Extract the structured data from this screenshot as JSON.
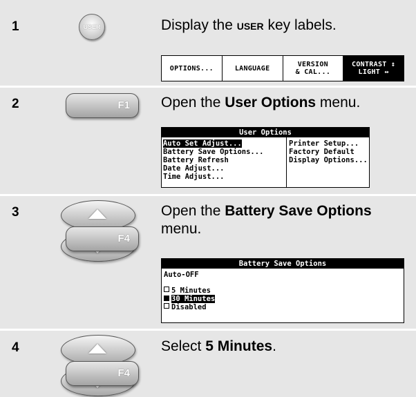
{
  "steps": [
    {
      "number": "1",
      "key": "USER",
      "instruction_pre": "Display the ",
      "instruction_key": "USER",
      "instruction_post": " key labels.",
      "softkeys": [
        "OPTIONS...",
        "LANGUAGE",
        "VERSION\n& CAL...",
        "CONTRAST ↕\nLIGHT ↔"
      ]
    },
    {
      "number": "2",
      "key": "F1",
      "instruction_pre": "Open the ",
      "instruction_bold": "User Options",
      "instruction_post": " menu.",
      "menu_title": "User Options",
      "left_items": [
        "Auto Set Adjust...",
        "Battery Save Options...",
        "Battery Refresh",
        "Date Adjust...",
        "Time Adjust..."
      ],
      "right_items": [
        "Printer Setup...",
        "Factory Default",
        "Display Options..."
      ]
    },
    {
      "number": "3",
      "key": "F4",
      "instruction_pre": "Open the ",
      "instruction_bold": "Battery Save Options",
      "instruction_post": " menu.",
      "menu_title": "Battery Save Options",
      "section_label": "Auto-OFF",
      "options": [
        "5 Minutes",
        "30 Minutes",
        "Disabled"
      ],
      "selected_option": "30 Minutes"
    },
    {
      "number": "4",
      "key": "F4",
      "instruction_pre": "Select ",
      "instruction_bold": "5 Minutes",
      "instruction_post": "."
    }
  ]
}
